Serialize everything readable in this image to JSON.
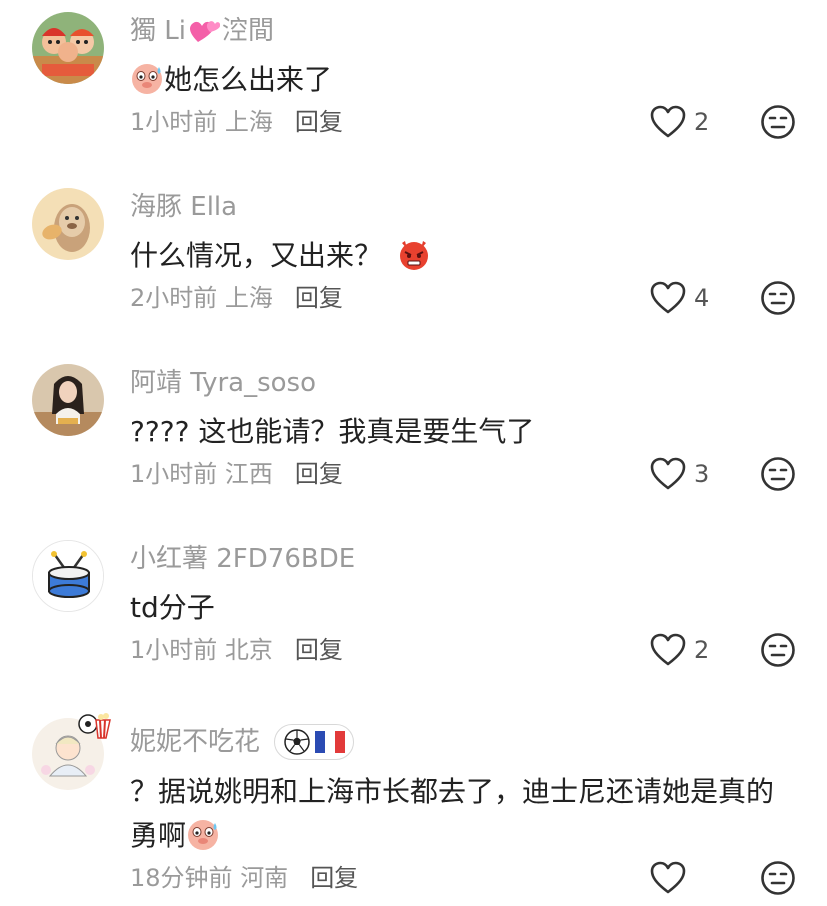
{
  "comments": [
    {
      "name_part1": "獨 Li",
      "name_part2": "涳間",
      "text": "她怎么出来了",
      "time": "1小时前",
      "location": "上海",
      "reply": "回复",
      "likes": "2",
      "avatar_icon": "cartoon-characters-avatar",
      "text_emoji": "sweating-pig-emoji"
    },
    {
      "name": "海豚 Ella",
      "text": "什么情况，又出来？",
      "time": "2小时前",
      "location": "上海",
      "reply": "回复",
      "likes": "4",
      "avatar_icon": "cartoon-seal-avatar",
      "text_emoji": "angry-devil-emoji"
    },
    {
      "name": "阿靖 Tyra_soso",
      "text": "???? 这也能请？我真是要生气了",
      "time": "1小时前",
      "location": "江西",
      "reply": "回复",
      "likes": "3",
      "avatar_icon": "woman-photo-avatar"
    },
    {
      "name": "小红薯 2FD76BDE",
      "text": "td分子",
      "time": "1小时前",
      "location": "北京",
      "reply": "回复",
      "likes": "2",
      "avatar_icon": "drum-avatar"
    },
    {
      "name": "妮妮不吃花",
      "text_line1": "？据说姚明和上海市长都去了，迪士尼还请她是真的",
      "text_line2": "勇啊",
      "time": "18分钟前",
      "location": "河南",
      "reply": "回复",
      "likes": "",
      "avatar_icon": "cartoon-girl-avatar",
      "badge_icons": [
        "soccer-ball-icon",
        "france-flag-icon"
      ],
      "text_emoji": "sweating-pig-emoji"
    }
  ],
  "colors": {
    "name": "#9a9a9a",
    "text": "#222222",
    "meta": "#9a9a9a",
    "icon": "#333333"
  }
}
